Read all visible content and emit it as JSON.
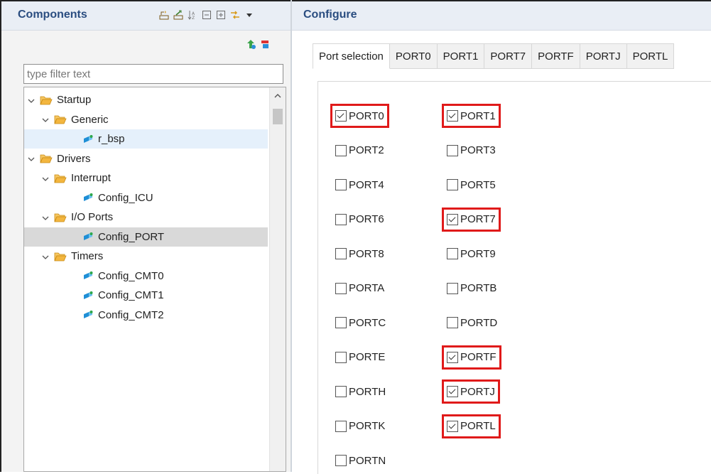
{
  "left": {
    "title": "Components",
    "filter_placeholder": "type filter text",
    "tree": [
      {
        "label": "Startup",
        "level": 0,
        "type": "folder",
        "expanded": true,
        "selected": "none"
      },
      {
        "label": "Generic",
        "level": 1,
        "type": "folder",
        "expanded": true,
        "selected": "none"
      },
      {
        "label": "r_bsp",
        "level": 2,
        "type": "component",
        "selected": "light"
      },
      {
        "label": "Drivers",
        "level": 0,
        "type": "folder",
        "expanded": true,
        "selected": "none"
      },
      {
        "label": "Interrupt",
        "level": 1,
        "type": "folder",
        "expanded": true,
        "selected": "none"
      },
      {
        "label": "Config_ICU",
        "level": 2,
        "type": "component",
        "selected": "none"
      },
      {
        "label": "I/O Ports",
        "level": 1,
        "type": "folder",
        "expanded": true,
        "selected": "none"
      },
      {
        "label": "Config_PORT",
        "level": 2,
        "type": "component",
        "selected": "grey"
      },
      {
        "label": "Timers",
        "level": 1,
        "type": "folder",
        "expanded": true,
        "selected": "none"
      },
      {
        "label": "Config_CMT0",
        "level": 2,
        "type": "component",
        "selected": "none"
      },
      {
        "label": "Config_CMT1",
        "level": 2,
        "type": "component",
        "selected": "none"
      },
      {
        "label": "Config_CMT2",
        "level": 2,
        "type": "component",
        "selected": "none"
      }
    ]
  },
  "right": {
    "title": "Configure",
    "tabs": [
      "Port selection",
      "PORT0",
      "PORT1",
      "PORT7",
      "PORTF",
      "PORTJ",
      "PORTL"
    ],
    "active_tab": 0,
    "ports": [
      {
        "label": "PORT0",
        "checked": true,
        "highlighted": true,
        "col": 0,
        "row": 0
      },
      {
        "label": "PORT1",
        "checked": true,
        "highlighted": true,
        "col": 1,
        "row": 0
      },
      {
        "label": "PORT2",
        "checked": false,
        "highlighted": false,
        "col": 0,
        "row": 1
      },
      {
        "label": "PORT3",
        "checked": false,
        "highlighted": false,
        "col": 1,
        "row": 1
      },
      {
        "label": "PORT4",
        "checked": false,
        "highlighted": false,
        "col": 0,
        "row": 2
      },
      {
        "label": "PORT5",
        "checked": false,
        "highlighted": false,
        "col": 1,
        "row": 2
      },
      {
        "label": "PORT6",
        "checked": false,
        "highlighted": false,
        "col": 0,
        "row": 3
      },
      {
        "label": "PORT7",
        "checked": true,
        "highlighted": true,
        "col": 1,
        "row": 3
      },
      {
        "label": "PORT8",
        "checked": false,
        "highlighted": false,
        "col": 0,
        "row": 4
      },
      {
        "label": "PORT9",
        "checked": false,
        "highlighted": false,
        "col": 1,
        "row": 4
      },
      {
        "label": "PORTA",
        "checked": false,
        "highlighted": false,
        "col": 0,
        "row": 5
      },
      {
        "label": "PORTB",
        "checked": false,
        "highlighted": false,
        "col": 1,
        "row": 5
      },
      {
        "label": "PORTC",
        "checked": false,
        "highlighted": false,
        "col": 0,
        "row": 6
      },
      {
        "label": "PORTD",
        "checked": false,
        "highlighted": false,
        "col": 1,
        "row": 6
      },
      {
        "label": "PORTE",
        "checked": false,
        "highlighted": false,
        "col": 0,
        "row": 7
      },
      {
        "label": "PORTF",
        "checked": true,
        "highlighted": true,
        "col": 1,
        "row": 7
      },
      {
        "label": "PORTH",
        "checked": false,
        "highlighted": false,
        "col": 0,
        "row": 8
      },
      {
        "label": "PORTJ",
        "checked": true,
        "highlighted": true,
        "col": 1,
        "row": 8
      },
      {
        "label": "PORTK",
        "checked": false,
        "highlighted": false,
        "col": 0,
        "row": 9
      },
      {
        "label": "PORTL",
        "checked": true,
        "highlighted": true,
        "col": 1,
        "row": 9
      },
      {
        "label": "PORTN",
        "checked": false,
        "highlighted": false,
        "col": 0,
        "row": 10
      }
    ]
  },
  "colors": {
    "header_bg": "#e9eef5",
    "title_text": "#2a4d80",
    "highlight_box": "#e01a1a",
    "selected_grey": "#d9d9d9",
    "selected_light": "#e5f0fb",
    "folder": "#e3a21a",
    "component": "#1f8fd6"
  },
  "icons": {
    "toolbar": [
      "collapse-tree-icon",
      "expand-tree-icon",
      "sort-az-icon",
      "collapse-all-icon",
      "expand-all-icon",
      "link-editor-icon",
      "view-menu-icon"
    ],
    "mini": [
      "add-component-icon",
      "remove-component-icon"
    ]
  }
}
